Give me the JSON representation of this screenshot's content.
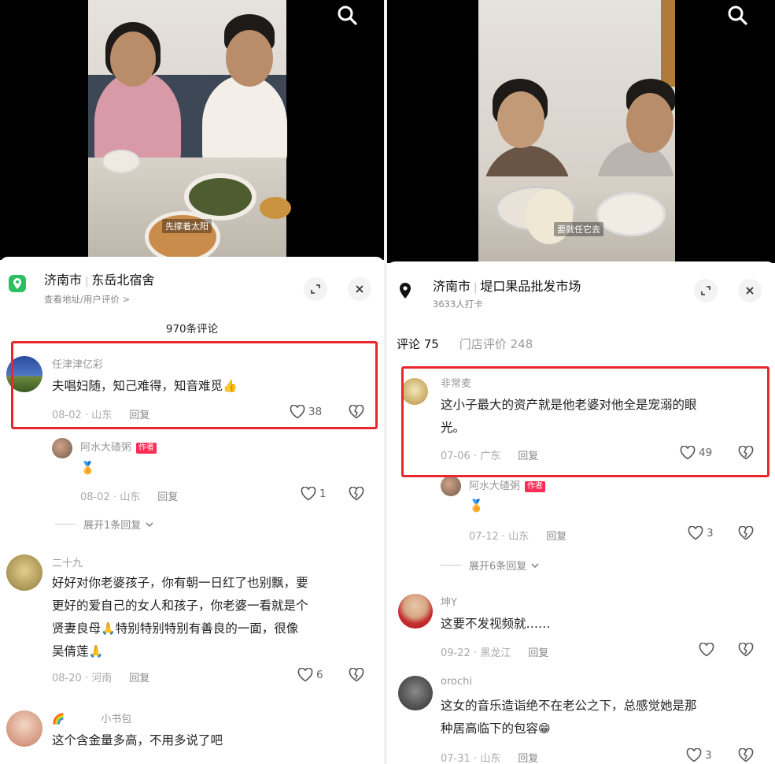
{
  "left": {
    "video": {
      "subtitle": "先撑着太阳"
    },
    "location": {
      "city": "济南市",
      "place": "东岳北宿舍",
      "sub": "查看地址/用户评价 >"
    },
    "comment_count": "970条评论",
    "comments": [
      {
        "user": "任津津亿彩",
        "text": "夫唱妇随，知己难得，知音难觅",
        "emoji": "👍",
        "date": "08-02",
        "region": "山东",
        "reply": "回复",
        "likes": "38"
      },
      {
        "user": "阿水大碴粥",
        "tag": "作者",
        "emoji": "🏅",
        "date": "08-02",
        "region": "山东",
        "reply": "回复",
        "likes": "1"
      },
      {
        "expand": "展开1条回复"
      },
      {
        "user": "二十九",
        "lines": [
          "好好对你老婆孩子，你有朝一日红了也别飘，要",
          "更好的爱自己的女人和孩子，你老婆一看就是个",
          "贤妻良母",
          "特别特别特别有善良的一面，很像",
          "吴倩莲"
        ],
        "date": "08-20",
        "region": "河南",
        "reply": "回复",
        "likes": "6"
      },
      {
        "user": "小书包",
        "text": "这个含金量多高，不用多说了吧"
      }
    ]
  },
  "right": {
    "video": {
      "subtitle": "要就任它去"
    },
    "location": {
      "city": "济南市",
      "place": "堤口果品批发市场",
      "sub": "3633人打卡"
    },
    "tabs": {
      "comments": "评论 75",
      "reviews": "门店评价 248"
    },
    "comments": [
      {
        "user": "非常麦",
        "lines": [
          "这小子最大的资产就是他老婆对他全是宠溺的眼",
          "光。"
        ],
        "date": "07-06",
        "region": "广东",
        "reply": "回复",
        "likes": "49"
      },
      {
        "user": "阿水大碴粥",
        "tag": "作者",
        "emoji": "🏅",
        "date": "07-12",
        "region": "山东",
        "reply": "回复",
        "likes": "3"
      },
      {
        "expand": "展开6条回复"
      },
      {
        "user": "坤Y",
        "text": "这要不发视频就……",
        "date": "09-22",
        "region": "黑龙江",
        "reply": "回复",
        "likes": ""
      },
      {
        "user": "orochi",
        "lines": [
          "这女的音乐造诣绝不在老公之下，总感觉她是那",
          "种居高临下的包容"
        ],
        "emoji": "😁",
        "date": "07-31",
        "region": "山东",
        "reply": "回复",
        "likes": "3"
      }
    ]
  },
  "colors": {
    "highlight": "#e8272c",
    "author_tag": "#fe2c55",
    "pin_green": "#2dbe60"
  },
  "icons": [
    "search-icon",
    "location-pin-icon",
    "expand-icon",
    "close-icon",
    "heart-icon",
    "broken-heart-icon",
    "chevron-down-icon"
  ]
}
